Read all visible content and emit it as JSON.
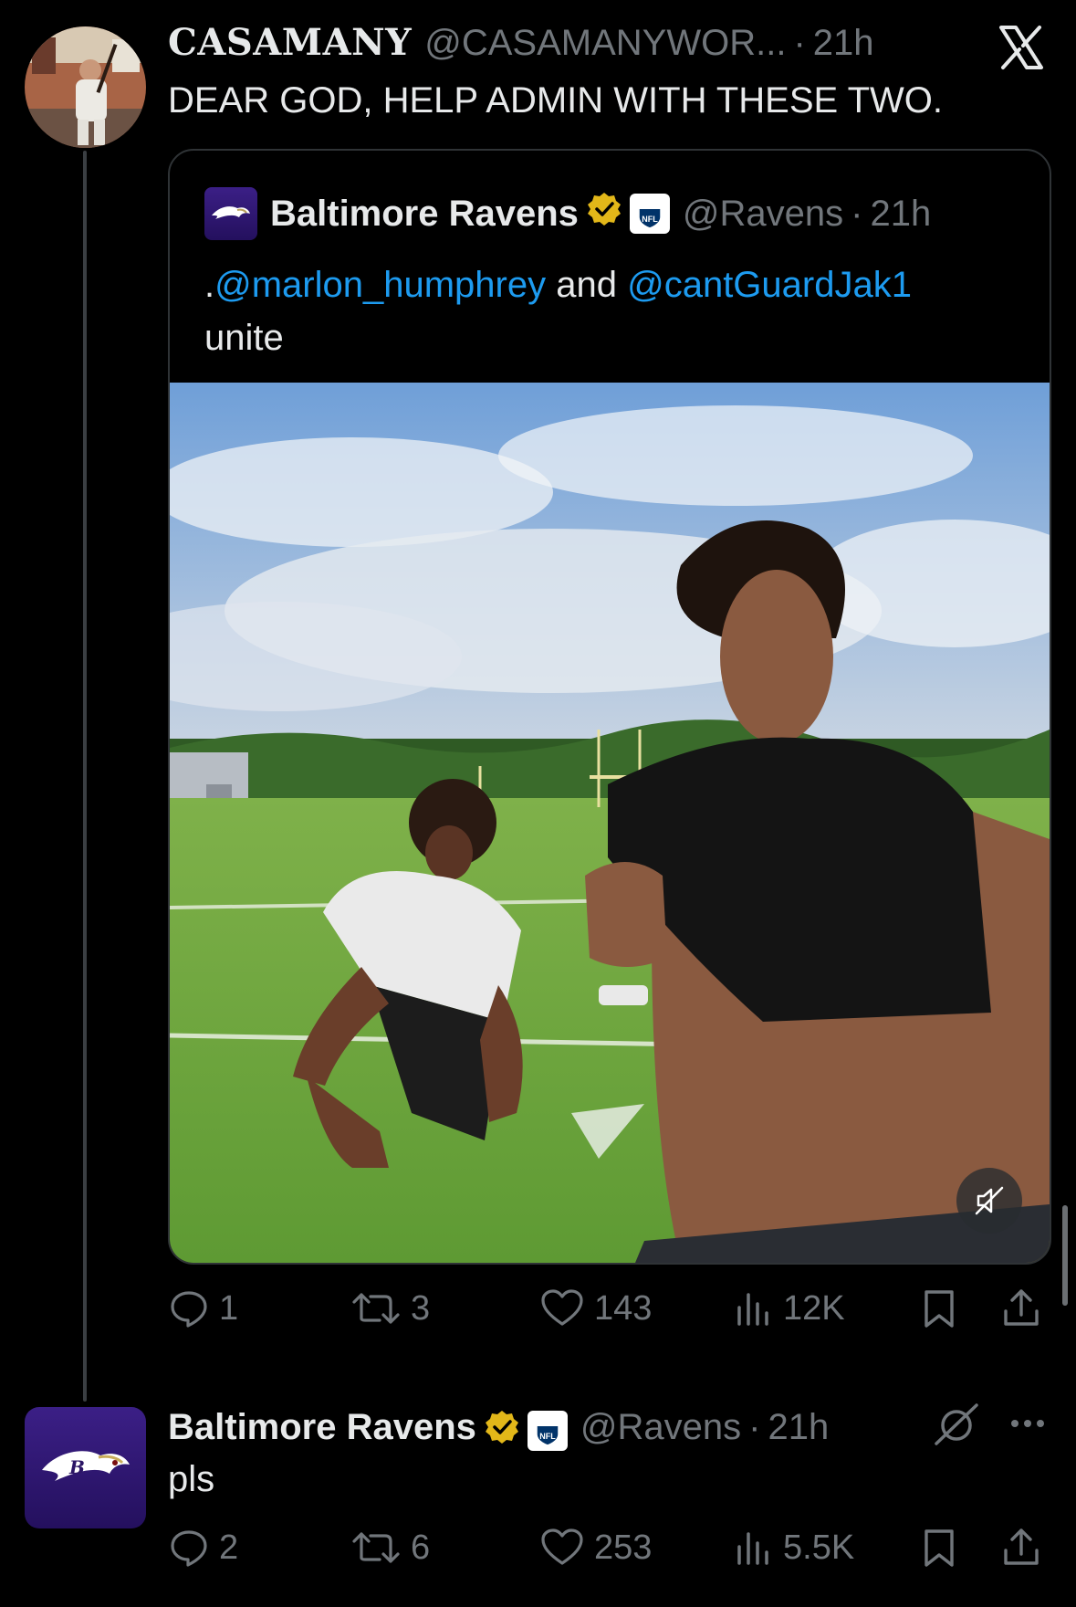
{
  "tweet1": {
    "display_name": "CASAMANY",
    "handle": "@CASAMANYWOR...",
    "dot": "·",
    "time": "21h",
    "text": "DEAR GOD, HELP ADMIN WITH THESE TWO."
  },
  "quote": {
    "display_name": "Baltimore Ravens",
    "handle": "@Ravens",
    "dot": "·",
    "time": "21h",
    "text_prefix": ".",
    "mention1": "@marlon_humphrey",
    "text_mid": " and ",
    "mention2": "@cantGuardJak1",
    "text_suffix": "unite"
  },
  "actions1": {
    "replies": "1",
    "reposts": "3",
    "likes": "143",
    "views": "12K"
  },
  "tweet2": {
    "display_name": "Baltimore Ravens",
    "handle": "@Ravens",
    "dot": "·",
    "time": "21h",
    "text": "pls"
  },
  "actions2": {
    "replies": "2",
    "reposts": "6",
    "likes": "253",
    "views": "5.5K"
  },
  "colors": {
    "background": "#000000",
    "text": "#e7e9ea",
    "muted": "#71767b",
    "link": "#1d9bf0",
    "verified": "#e2b719",
    "ravens_purple": "#2b1565"
  },
  "icons": [
    "x-logo-icon",
    "verified-badge-icon",
    "nfl-badge-icon",
    "reply-icon",
    "repost-icon",
    "like-icon",
    "views-icon",
    "bookmark-icon",
    "share-icon",
    "mute-icon",
    "grok-icon",
    "more-icon"
  ]
}
